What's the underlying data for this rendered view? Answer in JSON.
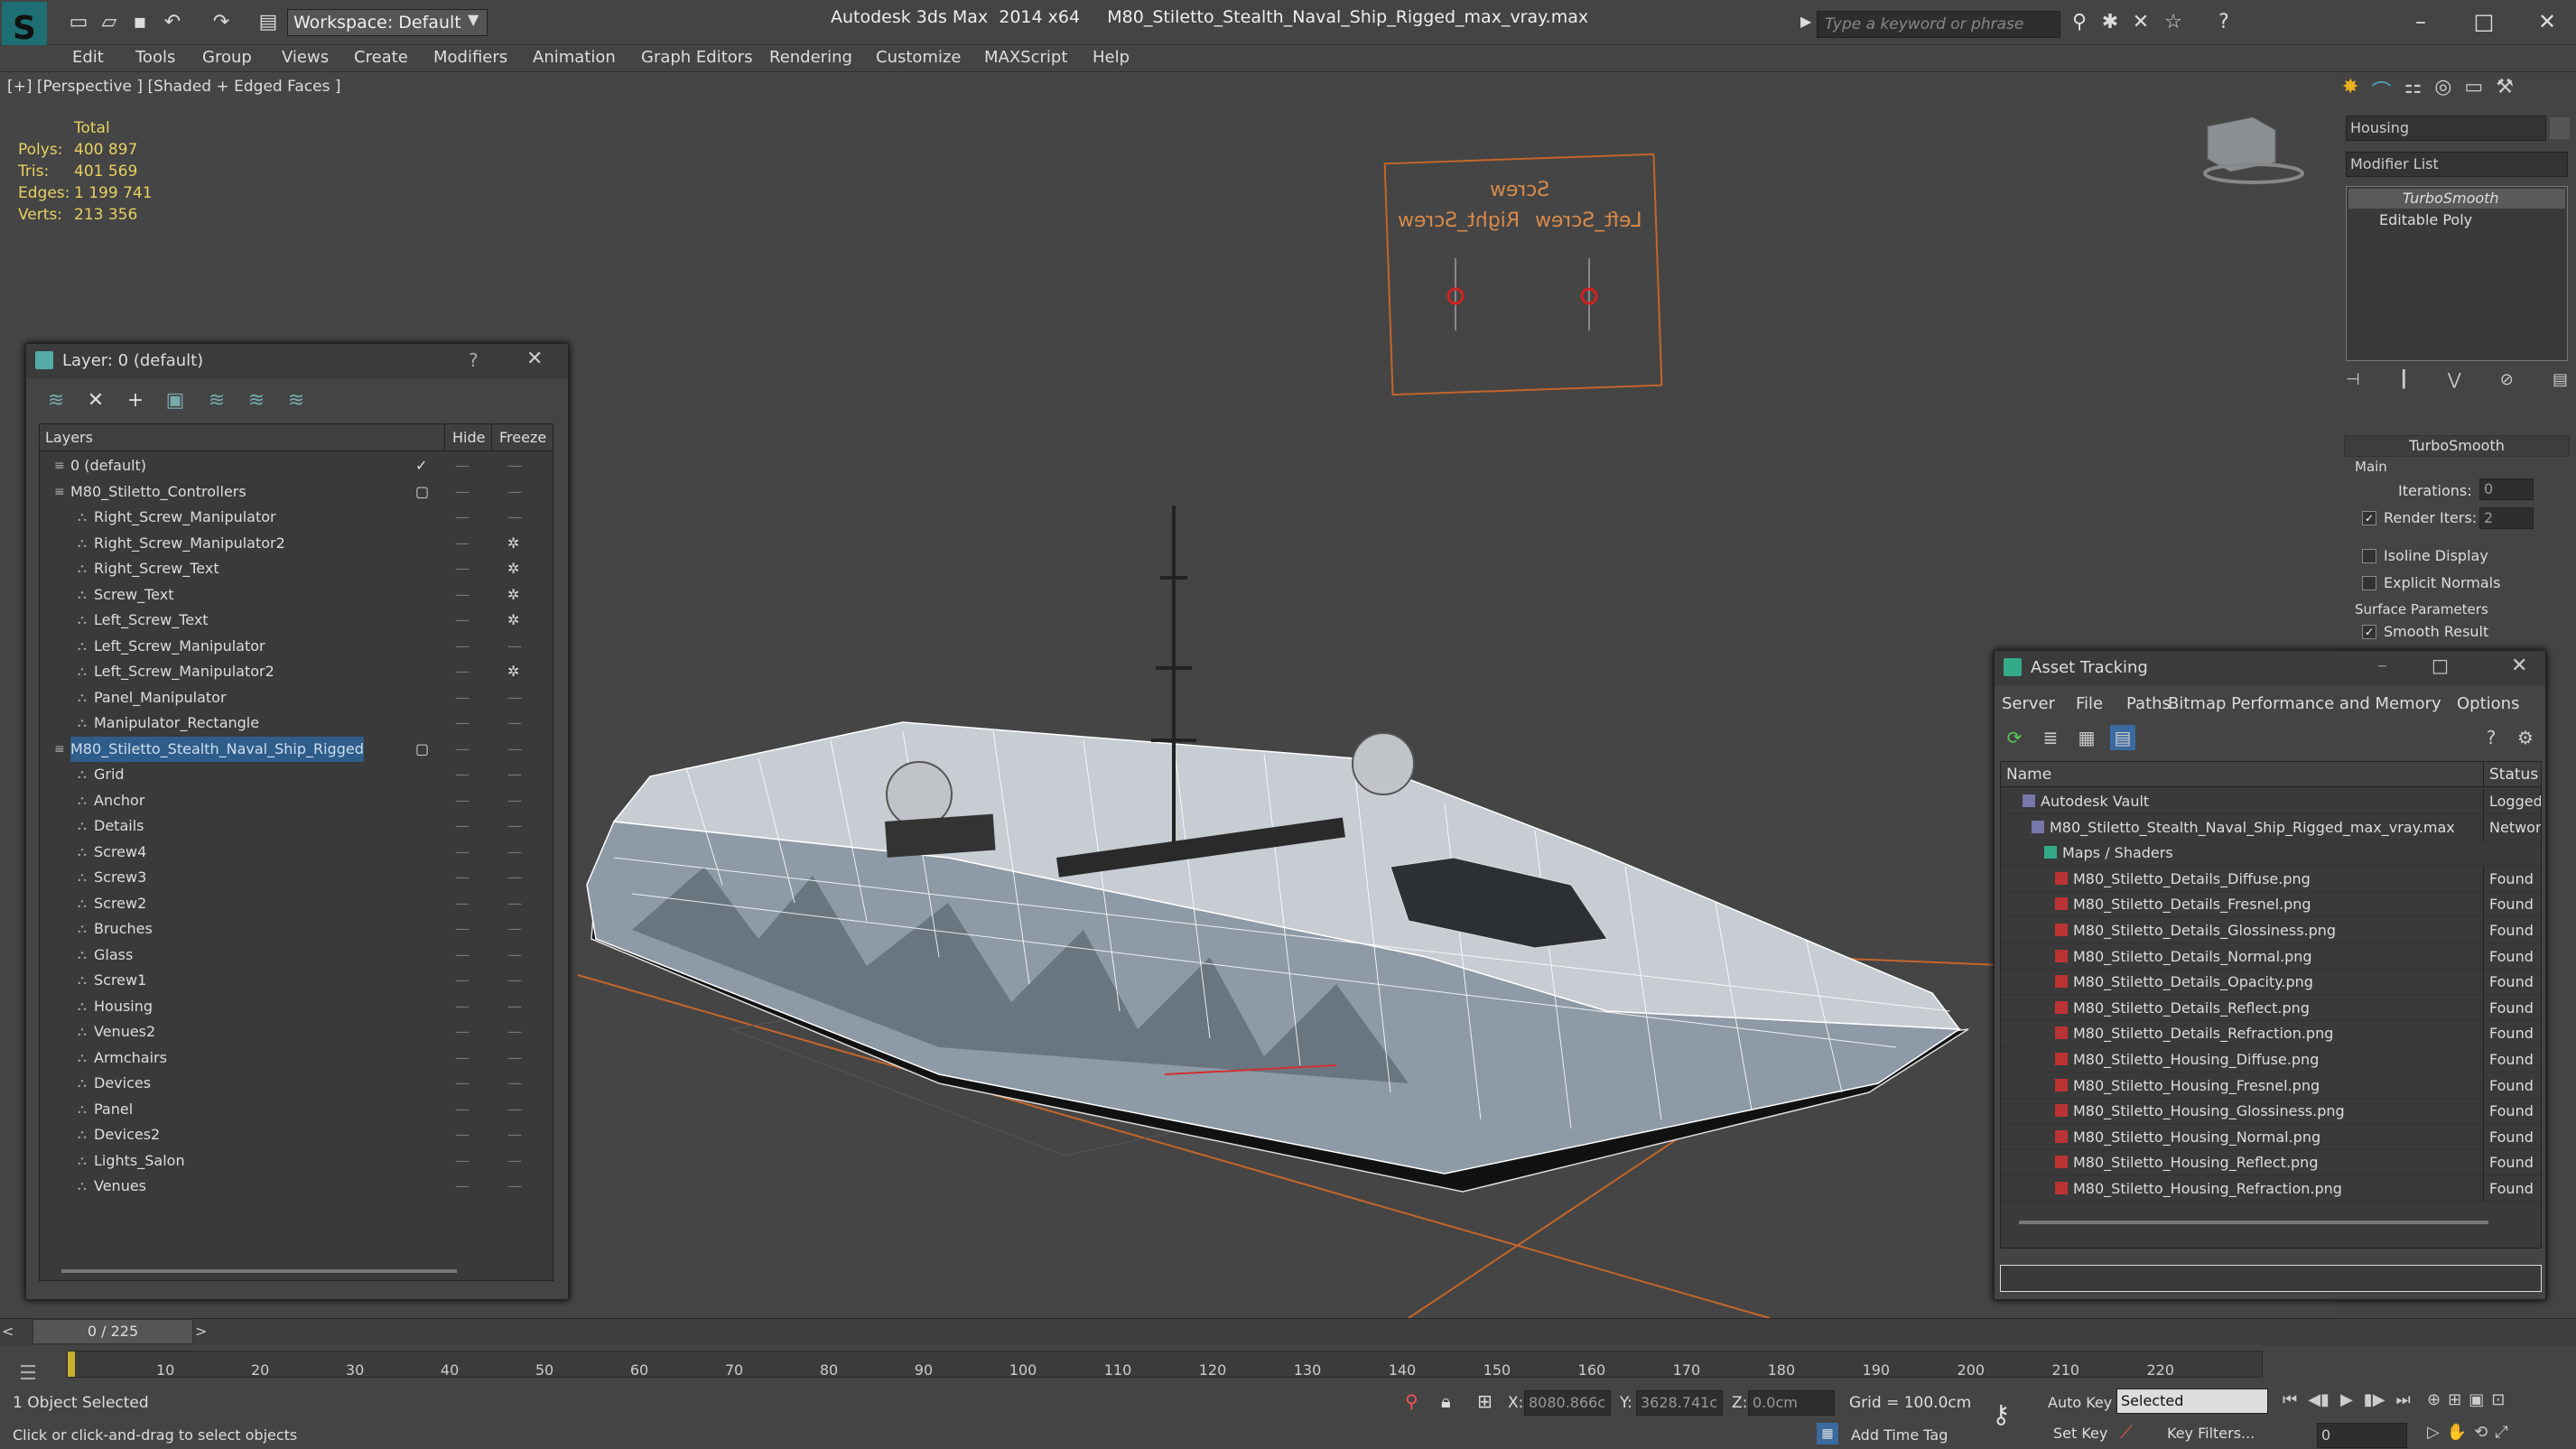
{
  "titlebar": {
    "workspace": "Workspace: Default",
    "app_title": "Autodesk 3ds Max  2014 x64     M80_Stiletto_Stealth_Naval_Ship_Rigged_max_vray.max",
    "search_placeholder": "Type a keyword or phrase"
  },
  "menu": [
    "Edit",
    "Tools",
    "Group",
    "Views",
    "Create",
    "Modifiers",
    "Animation",
    "Graph Editors",
    "Rendering",
    "Customize",
    "MAXScript",
    "Help"
  ],
  "viewport": {
    "label": "[+] [Perspective ] [Shaded + Edged Faces ]",
    "stats": {
      "total_label": "Total",
      "rows": [
        {
          "label": "Polys:",
          "value": "400 897"
        },
        {
          "label": "Tris:",
          "value": "401 569"
        },
        {
          "label": "Edges:",
          "value": "1 199 741"
        },
        {
          "label": "Verts:",
          "value": "213 356"
        }
      ]
    },
    "panel_text": {
      "screw": "Screw",
      "right": "Right_Screw",
      "left": "Left_Screw"
    }
  },
  "layer_window": {
    "title": "Layer: 0 (default)",
    "help": "?",
    "col_layers": "Layers",
    "col_hide": "Hide",
    "col_freeze": "Freeze",
    "rows": [
      {
        "name": "0 (default)",
        "level": 0
      },
      {
        "name": "M80_Stiletto_Controllers",
        "level": 0
      },
      {
        "name": "Right_Screw_Manipulator",
        "level": 1
      },
      {
        "name": "Right_Screw_Manipulator2",
        "level": 1
      },
      {
        "name": "Right_Screw_Text",
        "level": 1
      },
      {
        "name": "Screw_Text",
        "level": 1
      },
      {
        "name": "Left_Screw_Text",
        "level": 1
      },
      {
        "name": "Left_Screw_Manipulator",
        "level": 1
      },
      {
        "name": "Left_Screw_Manipulator2",
        "level": 1
      },
      {
        "name": "Panel_Manipulator",
        "level": 1
      },
      {
        "name": "Manipulator_Rectangle",
        "level": 1
      },
      {
        "name": "M80_Stiletto_Stealth_Naval_Ship_Rigged",
        "level": 0
      },
      {
        "name": "Grid",
        "level": 1
      },
      {
        "name": "Anchor",
        "level": 1
      },
      {
        "name": "Details",
        "level": 1
      },
      {
        "name": "Screw4",
        "level": 1
      },
      {
        "name": "Screw3",
        "level": 1
      },
      {
        "name": "Screw2",
        "level": 1
      },
      {
        "name": "Bruches",
        "level": 1
      },
      {
        "name": "Glass",
        "level": 1
      },
      {
        "name": "Screw1",
        "level": 1
      },
      {
        "name": "Housing",
        "level": 1
      },
      {
        "name": "Venues2",
        "level": 1
      },
      {
        "name": "Armchairs",
        "level": 1
      },
      {
        "name": "Devices",
        "level": 1
      },
      {
        "name": "Panel",
        "level": 1
      },
      {
        "name": "Devices2",
        "level": 1
      },
      {
        "name": "Lights_Salon",
        "level": 1
      },
      {
        "name": "Venues",
        "level": 1
      }
    ]
  },
  "command_panel": {
    "object_name": "Housing",
    "modifier_list": "Modifier List",
    "stack": [
      "TurboSmooth",
      "Editable Poly"
    ],
    "rollout_title": "TurboSmooth",
    "main_label": "Main",
    "iterations_label": "Iterations:",
    "iterations_value": "0",
    "render_iters_label": "Render Iters:",
    "render_iters_value": "2",
    "isoline": "Isoline Display",
    "explicit": "Explicit Normals",
    "surface": "Surface Parameters",
    "smooth": "Smooth Result"
  },
  "asset_tracking": {
    "title": "Asset Tracking",
    "menu": [
      "Server",
      "File",
      "Paths",
      "Bitmap Performance and Memory",
      "Options"
    ],
    "col_name": "Name",
    "col_status": "Status",
    "rows": [
      {
        "name": "Autodesk Vault",
        "status": "Logged",
        "level": 0
      },
      {
        "name": "M80_Stiletto_Stealth_Naval_Ship_Rigged_max_vray.max",
        "status": "Network",
        "level": 1
      },
      {
        "name": "Maps / Shaders",
        "status": "",
        "level": 2
      },
      {
        "name": "M80_Stiletto_Details_Diffuse.png",
        "status": "Found",
        "level": 3
      },
      {
        "name": "M80_Stiletto_Details_Fresnel.png",
        "status": "Found",
        "level": 3
      },
      {
        "name": "M80_Stiletto_Details_Glossiness.png",
        "status": "Found",
        "level": 3
      },
      {
        "name": "M80_Stiletto_Details_Normal.png",
        "status": "Found",
        "level": 3
      },
      {
        "name": "M80_Stiletto_Details_Opacity.png",
        "status": "Found",
        "level": 3
      },
      {
        "name": "M80_Stiletto_Details_Reflect.png",
        "status": "Found",
        "level": 3
      },
      {
        "name": "M80_Stiletto_Details_Refraction.png",
        "status": "Found",
        "level": 3
      },
      {
        "name": "M80_Stiletto_Housing_Diffuse.png",
        "status": "Found",
        "level": 3
      },
      {
        "name": "M80_Stiletto_Housing_Fresnel.png",
        "status": "Found",
        "level": 3
      },
      {
        "name": "M80_Stiletto_Housing_Glossiness.png",
        "status": "Found",
        "level": 3
      },
      {
        "name": "M80_Stiletto_Housing_Normal.png",
        "status": "Found",
        "level": 3
      },
      {
        "name": "M80_Stiletto_Housing_Reflect.png",
        "status": "Found",
        "level": 3
      },
      {
        "name": "M80_Stiletto_Housing_Refraction.png",
        "status": "Found",
        "level": 3
      }
    ]
  },
  "timeline": {
    "frame": "0 / 225",
    "ticks": [
      "10",
      "20",
      "30",
      "40",
      "50",
      "60",
      "70",
      "80",
      "90",
      "100",
      "110",
      "120",
      "130",
      "140",
      "150",
      "160",
      "170",
      "180",
      "190",
      "200",
      "210",
      "220"
    ]
  },
  "status": {
    "selected": "1 Object Selected",
    "prompt": "Click or click-and-drag to select objects",
    "x_label": "X:",
    "x_value": "8080.866c",
    "y_label": "Y:",
    "y_value": "3628.741c",
    "z_label": "Z:",
    "z_value": "0.0cm",
    "grid": "Grid = 100.0cm",
    "add_time_tag": "Add Time Tag",
    "auto_key": "Auto Key",
    "set_key": "Set Key",
    "selected_dropdown": "Selected",
    "key_filters": "Key Filters...",
    "frame_field": "0"
  }
}
